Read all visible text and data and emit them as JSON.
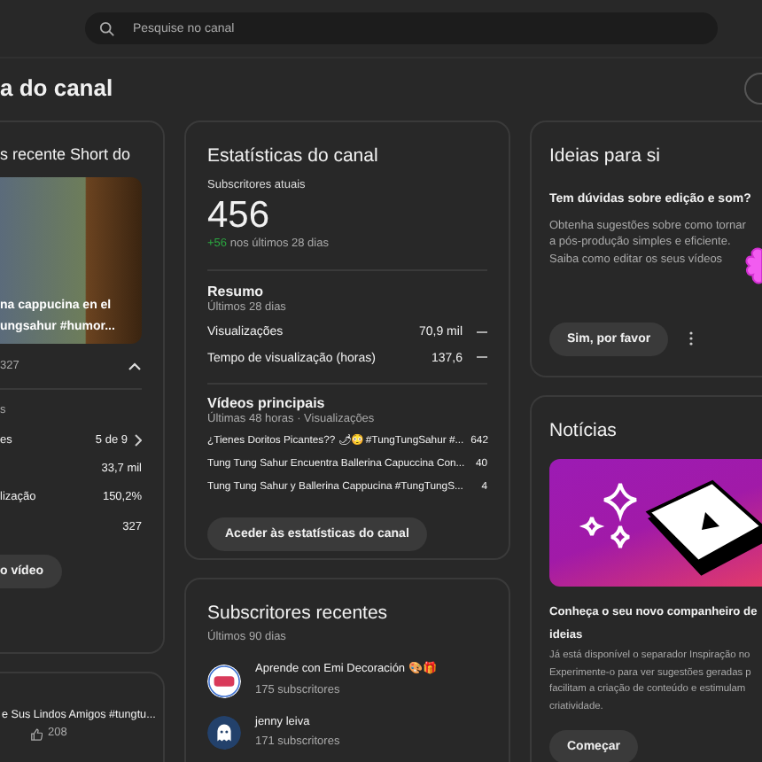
{
  "search": {
    "placeholder": "Pesquise no canal"
  },
  "page_title": "a do canal",
  "short_card": {
    "title": "s recente Short do",
    "thumbnail_caption": [
      "na cappucina en el",
      "ungsahur #humor..."
    ],
    "views": "327",
    "expanded": true,
    "section": "s",
    "rows": [
      {
        "label": "es",
        "value": "5 de 9",
        "kind": "link"
      },
      {
        "label": "",
        "value": "33,7 mil",
        "kind": "plain"
      },
      {
        "label": "lização",
        "value": "150,2%",
        "kind": "plain"
      },
      {
        "label": "",
        "value": "327",
        "kind": "plain"
      }
    ],
    "button": "o vídeo"
  },
  "short_card_2": {
    "title": "e Sus Lindos Amigos #tungtu...",
    "likes": "208"
  },
  "stats": {
    "title": "Estatísticas do canal",
    "subs_label": "Subscritores atuais",
    "subs": "456",
    "delta": "+56",
    "delta_text": "nos últimos 28 dias",
    "summary_title": "Resumo",
    "summary_period": "Últimos 28 dias",
    "metrics": [
      {
        "label": "Visualizações",
        "value": "70,9 mil"
      },
      {
        "label": "Tempo de visualização (horas)",
        "value": "137,6"
      }
    ],
    "top_title": "Vídeos principais",
    "top_period": "Últimas 48 horas · Visualizações",
    "top_videos": [
      {
        "title": "¿Tienes Doritos Picantes?? 🌶😳 #TungTungSahur #...",
        "views": "642"
      },
      {
        "title": "Tung Tung Sahur Encuentra Ballerina Capuccina Con...",
        "views": "40"
      },
      {
        "title": "Tung Tung Sahur y Ballerina Cappucina #TungTungS...",
        "views": "4"
      }
    ],
    "button": "Aceder às estatísticas do canal"
  },
  "subscribers": {
    "title": "Subscritores recentes",
    "period": "Últimos 90 dias",
    "items": [
      {
        "name": "Aprende con Emi Decoración 🎨🎁",
        "count": "175 subscritores",
        "kind": "logo"
      },
      {
        "name": "jenny leiva",
        "count": "171 subscritores",
        "kind": "ghost"
      }
    ]
  },
  "ideas": {
    "title": "Ideias para si",
    "question": "Tem dúvidas sobre edição e som?",
    "text": "Obtenha sugestões sobre como tornar a pós-produção simples e eficiente. Saiba como editar os seus vídeos",
    "button": "Sim, por favor"
  },
  "news": {
    "title": "Notícias",
    "headline": [
      "Conheça o seu novo companheiro de",
      "ideias"
    ],
    "body": [
      "Já está disponível o separador Inspiração no",
      "Experimente-o para ver sugestões geradas p",
      "facilitam a criação de conteúdo e estimulam",
      "criatividade."
    ],
    "button": "Começar"
  }
}
